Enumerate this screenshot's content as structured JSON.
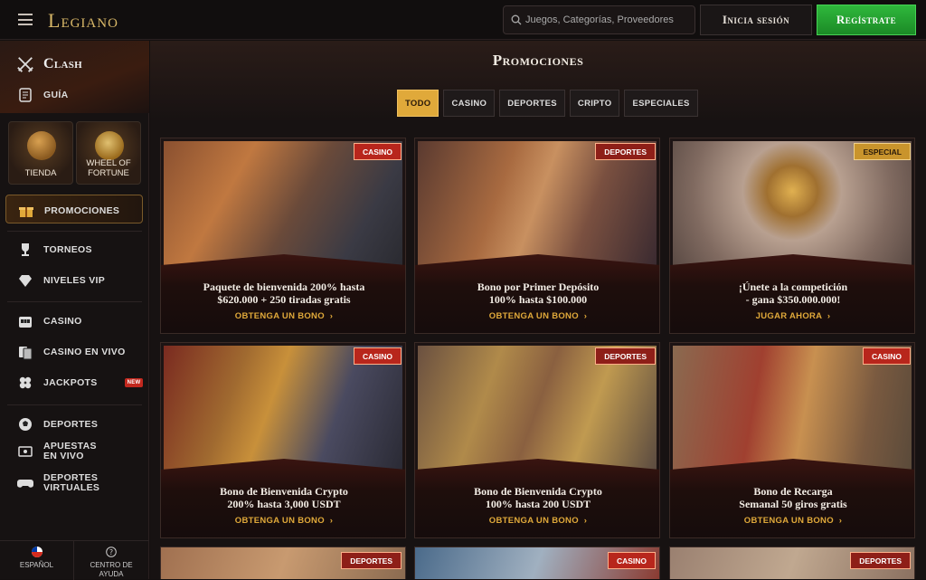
{
  "header": {
    "logo": "Legiano",
    "search_placeholder": "Juegos, Categorías, Proveedores",
    "login_label": "Inicia sesión",
    "register_label": "Regístrate"
  },
  "sidebar": {
    "clash": "Clash",
    "guide": "GUÍA",
    "tiles": [
      {
        "label": "TIENDA"
      },
      {
        "label": "WHEEL OF FORTUNE"
      }
    ],
    "promotions": "PROMOCIONES",
    "group1": [
      {
        "label": "TORNEOS",
        "icon": "trophy-icon"
      },
      {
        "label": "NIVELES VIP",
        "icon": "diamond-icon"
      }
    ],
    "group2": [
      {
        "label": "CASINO",
        "icon": "slot-machine-icon"
      },
      {
        "label": "CASINO EN VIVO",
        "icon": "cards-icon"
      },
      {
        "label": "JACKPOTS",
        "icon": "clover-icon",
        "badge": "NEW"
      }
    ],
    "group3": [
      {
        "label": "DEPORTES",
        "icon": "ball-icon"
      },
      {
        "label": "APUESTAS EN VIVO",
        "icon": "live-icon"
      },
      {
        "label": "DEPORTES VIRTUALES",
        "icon": "gamepad-icon"
      }
    ],
    "footer": {
      "language": "ESPAÑOL",
      "help": "CENTRO DE AYUDA"
    }
  },
  "main": {
    "title": "Promociones",
    "filters": [
      "TODO",
      "CASINO",
      "DEPORTES",
      "CRIPTO",
      "ESPECIALES"
    ],
    "active_filter": "TODO",
    "cards": [
      {
        "tag": "CASINO",
        "title_line1": "Paquete de bienvenida 200% hasta",
        "title_line2": "$620.000 + 250 tiradas gratis",
        "cta": "OBTENGA UN BONO"
      },
      {
        "tag": "DEPORTES",
        "title_line1": "Bono por Primer Depósito",
        "title_line2": "100% hasta $100.000",
        "cta": "OBTENGA UN BONO"
      },
      {
        "tag": "ESPECIAL",
        "title_line1": "¡Únete a la competición",
        "title_line2": "- gana $350.000.000!",
        "cta": "JUGAR AHORA"
      },
      {
        "tag": "CASINO",
        "title_line1": "Bono de Bienvenida Crypto",
        "title_line2": "200% hasta 3,000 USDT",
        "cta": "OBTENGA UN BONO"
      },
      {
        "tag": "DEPORTES",
        "title_line1": "Bono de Bienvenida Crypto",
        "title_line2": "100% hasta 200 USDT",
        "cta": "OBTENGA UN BONO"
      },
      {
        "tag": "CASINO",
        "title_line1": "Bono de Recarga",
        "title_line2": "Semanal 50 giros gratis",
        "cta": "OBTENGA UN BONO"
      }
    ],
    "peek_tags": [
      "DEPORTES",
      "CASINO",
      "DEPORTES"
    ]
  },
  "colors": {
    "accent_gold": "#e0a93a",
    "register_green": "#1b8a26",
    "casino_red": "#b8261c"
  }
}
